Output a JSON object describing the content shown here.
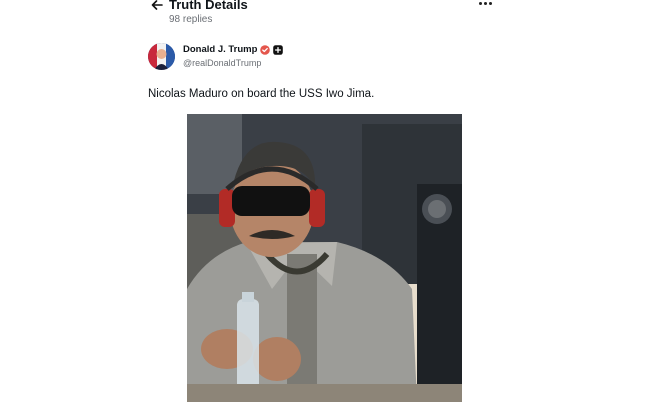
{
  "header": {
    "title": "Truth Details",
    "replies": "98 replies",
    "back_icon": "arrow-left-icon",
    "more_icon": "more-horizontal-icon"
  },
  "post": {
    "author": {
      "display_name": "Donald J. Trump",
      "handle": "@realDonaldTrump",
      "verified_icon": "verified-badge-icon",
      "badge_icon": "plus-badge-icon"
    },
    "text": "Nicolas Maduro on board the USS Iwo Jima."
  },
  "colors": {
    "verified": "#e4564c",
    "muted_text": "#6b6f75",
    "text": "#0f1419"
  }
}
